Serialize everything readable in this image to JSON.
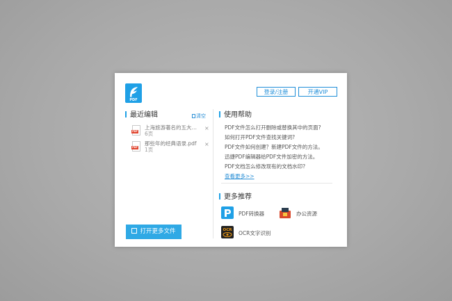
{
  "header": {
    "logo_text": "PDF",
    "login_label": "登录/注册",
    "vip_label": "开通VIP"
  },
  "recent": {
    "title": "最近编辑",
    "clear_label": "清空",
    "files": [
      {
        "name": "上海旅游著名的五大景点",
        "size": "6页"
      },
      {
        "name": "那些年的经典语录.pdf",
        "size": "1页"
      }
    ],
    "open_more_label": "打开更多文件"
  },
  "help": {
    "title": "使用帮助",
    "items": [
      "PDF文件怎么打开删除或替换其中的页面?",
      "如何打开PDF文件查找关键词?",
      "PDF文件如何创建？新建PDF文件的方法。",
      "迅捷PDF编辑器给PDF文件加密的方法。",
      "PDF文档怎么修改现有的文档水印?"
    ],
    "more_label": "查看更多>>"
  },
  "recommend": {
    "title": "更多推荐",
    "items": [
      {
        "label": "PDF转换器",
        "icon": "pdf-converter-icon",
        "color": "#1fa0e6"
      },
      {
        "label": "办公资源",
        "icon": "office-resource-icon",
        "color": "#d9492c"
      },
      {
        "label": "OCR文字识别",
        "icon": "ocr-icon",
        "color": "#222222"
      }
    ]
  },
  "colors": {
    "accent": "#1fa0e6",
    "link": "#2a8fd6"
  }
}
